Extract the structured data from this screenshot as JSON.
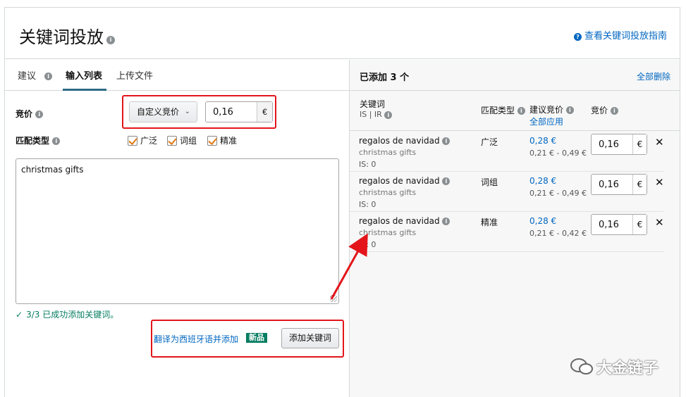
{
  "header": {
    "title": "关键词投放",
    "guide_link": "查看关键词投放指南"
  },
  "tabs": [
    {
      "label": "建议"
    },
    {
      "label": "输入列表"
    },
    {
      "label": "上传文件"
    }
  ],
  "form": {
    "bid_label": "竞价",
    "bid_strategy": "自定义竞价",
    "bid_value": "0,16",
    "currency": "€",
    "match_label": "匹配类型",
    "match_types": [
      "广泛",
      "词组",
      "精准"
    ],
    "keywords_text": "christmas gifts",
    "success_msg": "3/3 已成功添加关键词。",
    "translate_link": "翻译为西班牙语并添加",
    "new_badge": "新品",
    "add_button": "添加关键词"
  },
  "added": {
    "title": "已添加 3 个",
    "delete_all": "全部删除",
    "columns": {
      "keyword": "关键词",
      "keyword_sub": "IS | IR",
      "match": "匹配类型",
      "suggested": "建议竞价",
      "apply_all": "全部应用",
      "bid": "竞价"
    },
    "rows": [
      {
        "keyword": "regalos de navidad",
        "translation": "christmas gifts",
        "is": "IS: 0",
        "match": "广泛",
        "suggested": "0,28 €",
        "range": "0,21 € - 0,49 €",
        "bid": "0,16",
        "currency": "€"
      },
      {
        "keyword": "regalos de navidad",
        "translation": "christmas gifts",
        "is": "IS: 0",
        "match": "词组",
        "suggested": "0,28 €",
        "range": "0,21 € - 0,49 €",
        "bid": "0,16",
        "currency": "€"
      },
      {
        "keyword": "regalos de navidad",
        "translation": "christmas gifts",
        "is": "IS: 0",
        "match": "精准",
        "suggested": "0,28 €",
        "range": "0,21 € - 0,42 €",
        "bid": "0,16",
        "currency": "€"
      }
    ]
  },
  "watermark": "大金链子"
}
